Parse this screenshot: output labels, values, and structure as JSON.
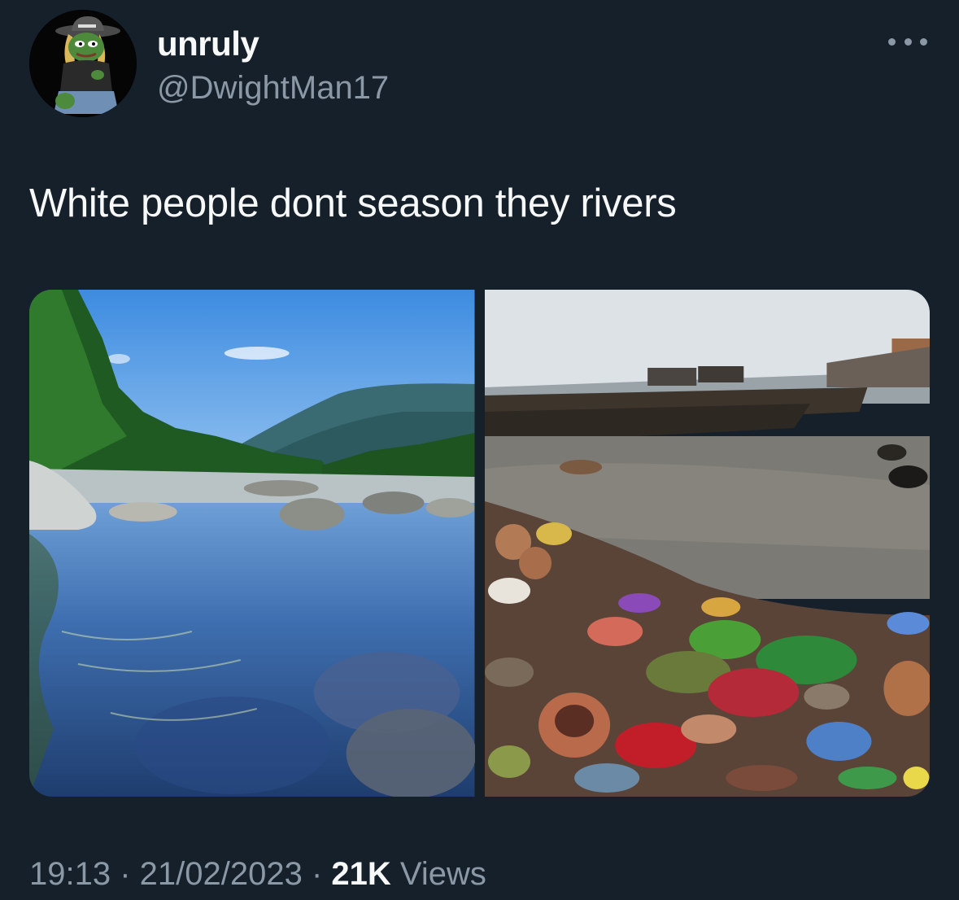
{
  "user": {
    "display_name": "unruly",
    "handle": "@DwightMan17",
    "avatar_icon": "pepe-cowboy-avatar-icon"
  },
  "tweet": {
    "text": "White people dont season they rivers"
  },
  "media": {
    "photo_left_icon": "clean-river-photo",
    "photo_right_icon": "polluted-river-photo"
  },
  "meta": {
    "time": "19:13",
    "separator": " · ",
    "date": "21/02/2023",
    "views_count": "21K",
    "views_label": "Views"
  },
  "colors": {
    "background": "#15202b",
    "text_primary": "#f7f9f9",
    "text_secondary": "#8b98a5"
  }
}
